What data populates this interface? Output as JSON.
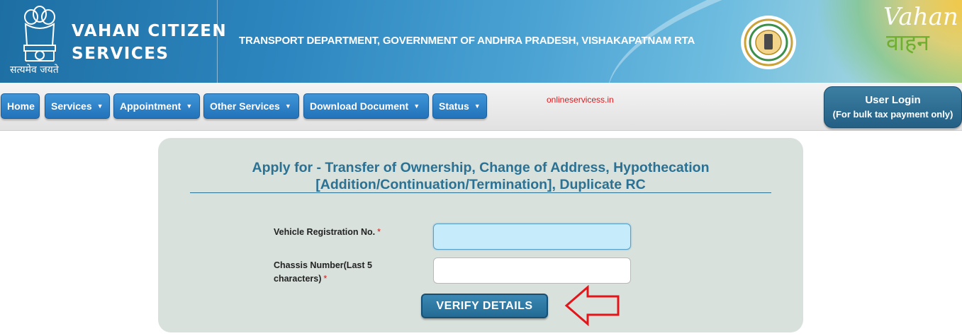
{
  "header": {
    "emblem_caption": "सत्यमेव जयते",
    "brand_line1": "VAHAN CITIZEN",
    "brand_line2": "SERVICES",
    "department": "TRANSPORT DEPARTMENT, GOVERNMENT OF ANDHRA PRADESH, VISHAKAPATNAM RTA",
    "vahan_logo_latin": "Vahan",
    "vahan_logo_native": "वाहन"
  },
  "nav": {
    "items": [
      {
        "label": "Home",
        "dropdown": false
      },
      {
        "label": "Services",
        "dropdown": true
      },
      {
        "label": "Appointment",
        "dropdown": true
      },
      {
        "label": "Other Services",
        "dropdown": true
      },
      {
        "label": "Download Document",
        "dropdown": true
      },
      {
        "label": "Status",
        "dropdown": true
      }
    ],
    "caret": "▼",
    "watermark": "onlineservicess.in",
    "user_login": {
      "title": "User Login",
      "subtitle": "(For bulk tax payment only)"
    }
  },
  "form": {
    "title_line1": "Apply for - Transfer of Ownership, Change of Address, Hypothecation",
    "title_line2": "[Addition/Continuation/Termination], Duplicate RC",
    "vehicle_reg_label": "Vehicle Registration No.",
    "vehicle_reg_value": "",
    "chassis_label_line1": "Chassis Number(Last 5",
    "chassis_label_line2": "characters)",
    "chassis_value": "",
    "required_mark": "*",
    "verify_button": "VERIFY DETAILS"
  },
  "colors": {
    "header_blue": "#2d86bf",
    "nav_button": "#2a7fc4",
    "title_teal": "#2a7193",
    "panel_bg": "#d8e1dc",
    "focus_input": "#c6ecfb",
    "arrow_red": "#e3151a"
  }
}
